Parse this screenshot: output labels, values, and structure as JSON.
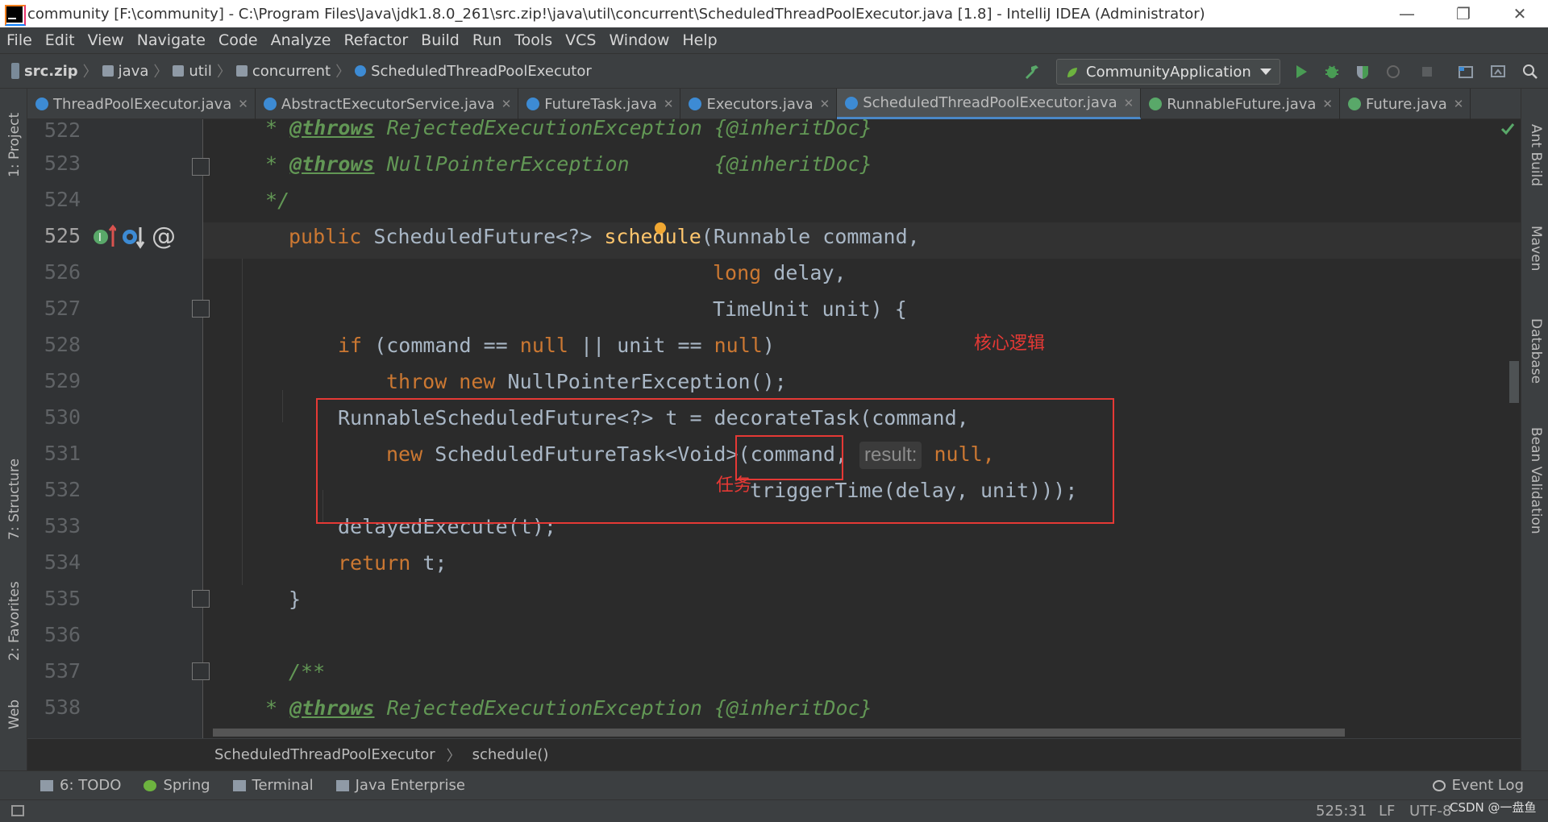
{
  "window": {
    "title": "community [F:\\community] - C:\\Program Files\\Java\\jdk1.8.0_261\\src.zip!\\java\\util\\concurrent\\ScheduledThreadPoolExecutor.java [1.8] - IntelliJ IDEA (Administrator)",
    "controls": [
      "—",
      "❐",
      "✕"
    ]
  },
  "menu": [
    "File",
    "Edit",
    "View",
    "Navigate",
    "Code",
    "Analyze",
    "Refactor",
    "Build",
    "Run",
    "Tools",
    "VCS",
    "Window",
    "Help"
  ],
  "breadcrumb": [
    "src.zip",
    "java",
    "util",
    "concurrent",
    "ScheduledThreadPoolExecutor"
  ],
  "run_config": "CommunityApplication",
  "tabs": [
    {
      "label": "ThreadPoolExecutor.java",
      "active": false
    },
    {
      "label": "AbstractExecutorService.java",
      "active": false
    },
    {
      "label": "FutureTask.java",
      "active": false
    },
    {
      "label": "Executors.java",
      "active": false
    },
    {
      "label": "ScheduledThreadPoolExecutor.java",
      "active": true
    },
    {
      "label": "RunnableFuture.java",
      "active": false
    },
    {
      "label": "Future.java",
      "active": false
    }
  ],
  "left_tools": [
    "1: Project",
    "7: Structure",
    "2: Favorites",
    "Web"
  ],
  "right_tools": [
    "Ant Build",
    "Maven",
    "Database",
    "Bean Validation"
  ],
  "line_numbers": [
    "522",
    "523",
    "524",
    "525",
    "526",
    "527",
    "528",
    "529",
    "530",
    "531",
    "532",
    "533",
    "534",
    "535",
    "536",
    "537",
    "538"
  ],
  "code": {
    "l522_star": " * ",
    "l522_tag": "@throws",
    "l522_ex": " RejectedExecutionException ",
    "l522_doc": "{@inheritDoc}",
    "l523_star": " * ",
    "l523_tag": "@throws",
    "l523_ex": " NullPointerException       ",
    "l523_doc": "{@inheritDoc}",
    "l524": " */",
    "l525_pub": "public ",
    "l525_type": "ScheduledFuture<?> ",
    "l525_fn": "schedule",
    "l525_rest": "(Runnable command,",
    "l526_kw": "long",
    "l526_rest": " delay,",
    "l527": "TimeUnit unit) {",
    "l528_if": "if",
    "l528_a": " (command == ",
    "l528_null1": "null",
    "l528_b": " || unit == ",
    "l528_null2": "null",
    "l528_c": ")",
    "l529_throw": "throw new ",
    "l529_rest": "NullPointerException();",
    "l530": "RunnableScheduledFuture<?> t = decorateTask(command,",
    "l531_new": "new ",
    "l531_type": "ScheduledFutureTask<Void>",
    "l531_arg": "(command,",
    "l531_hint": "result:",
    "l531_null": "null,",
    "l532": "triggerTime(delay, unit)));",
    "l533": "delayedExecute(t);",
    "l534_ret": "return",
    "l534_rest": " t;",
    "l535": "}",
    "l537": "/**",
    "l538_star": " * ",
    "l538_tag": "@throws",
    "l538_ex": " RejectedExecutionException ",
    "l538_doc": "{@inheritDoc}"
  },
  "annotations": {
    "core_logic": "核心逻辑",
    "task": "任务"
  },
  "editor_breadcrumb": [
    "ScheduledThreadPoolExecutor",
    "schedule()"
  ],
  "tool_windows": [
    "6: TODO",
    "Spring",
    "Terminal",
    "Java Enterprise"
  ],
  "event_log": "Event Log",
  "status": {
    "position": "525:31",
    "line_sep": "LF",
    "encoding": "UTF-8",
    "watermark": "CSDN @一盘鱼"
  },
  "colors": {
    "editor_bg": "#2b2b2b",
    "keyword": "#cc7832",
    "comment": "#629755",
    "function": "#ffc66d",
    "annotation_red": "#e53935"
  }
}
